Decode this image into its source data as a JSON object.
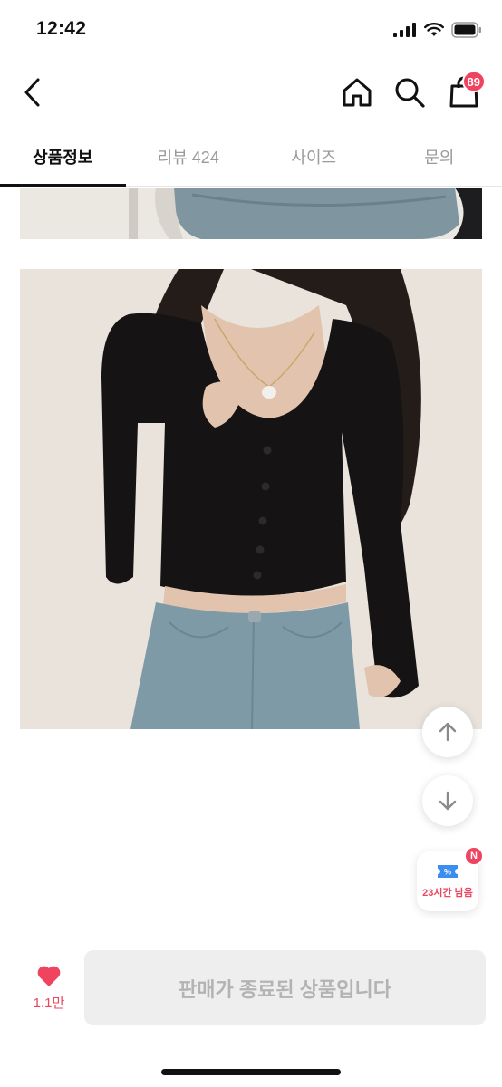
{
  "status_bar": {
    "time": "12:42"
  },
  "header": {
    "icons": {
      "back": "chevron-left-icon",
      "home": "home-icon",
      "search": "search-icon",
      "cart": "shopping-bag-icon"
    },
    "cart_badge": "89"
  },
  "tabs": [
    {
      "label": "상품정보",
      "active": true
    },
    {
      "label": "리뷰 424",
      "active": false
    },
    {
      "label": "사이즈",
      "active": false
    },
    {
      "label": "문의",
      "active": false
    }
  ],
  "floating": {
    "scroll_up_icon": "arrow-up-icon",
    "scroll_down_icon": "arrow-down-icon",
    "coupon_text": "23시간 남음",
    "coupon_badge": "N"
  },
  "bottom_bar": {
    "like_count": "1.1만",
    "cta_label": "판매가 종료된 상품입니다"
  },
  "colors": {
    "accent": "#f0435f",
    "disabled_bg": "#eeeeee",
    "disabled_text": "#b3b3b3"
  }
}
